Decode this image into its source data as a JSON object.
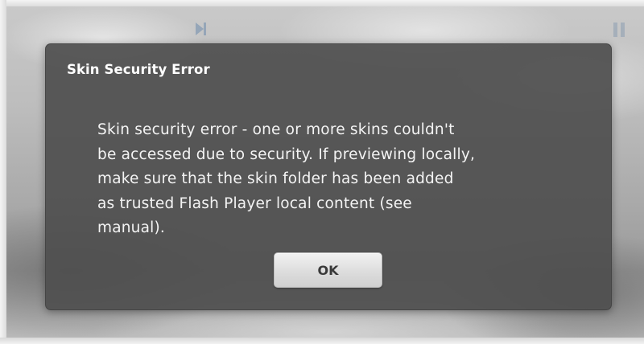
{
  "dialog": {
    "title": "Skin Security Error",
    "message": "Skin security error - one or more skins couldn't\nbe accessed due to security.  If previewing locally,\nmake sure that the skin folder has been added\nas trusted Flash Player local content (see\nmanual).",
    "ok_label": "OK"
  },
  "player": {
    "icons": [
      "skip-icon",
      "pause-icon"
    ]
  },
  "colors": {
    "dialog_bg": "#4e4e4e",
    "title_text": "#ffffff",
    "message_text": "#f4f4f4",
    "button_text": "#3a3a3a"
  }
}
